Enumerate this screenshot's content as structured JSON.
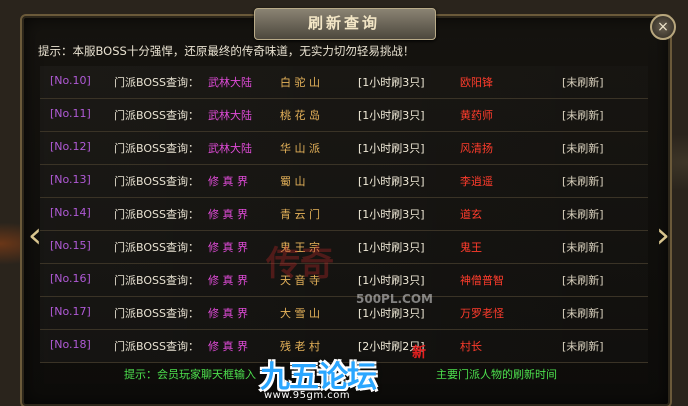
{
  "window": {
    "title": "刷新查询",
    "close_glyph": "×"
  },
  "tip_top": "提示：本服BOSS十分强悍，还原最终的传奇味道，无实力切勿轻易挑战！",
  "rows": [
    {
      "no": "[No.10]",
      "label": "门派BOSS查询：",
      "realm": "武林大陆",
      "place": "白 驼 山",
      "rate": "[1小时刷3只]",
      "boss": "欧阳锋",
      "status": "[未刷新]"
    },
    {
      "no": "[No.11]",
      "label": "门派BOSS查询：",
      "realm": "武林大陆",
      "place": "桃 花 岛",
      "rate": "[1小时刷3只]",
      "boss": "黄药师",
      "status": "[未刷新]"
    },
    {
      "no": "[No.12]",
      "label": "门派BOSS查询：",
      "realm": "武林大陆",
      "place": "华 山 派",
      "rate": "[1小时刷3只]",
      "boss": "风清扬",
      "status": "[未刷新]"
    },
    {
      "no": "[No.13]",
      "label": "门派BOSS查询：",
      "realm": "修 真 界",
      "place": "蜀  山",
      "rate": "[1小时刷3只]",
      "boss": "李逍遥",
      "status": "[未刷新]"
    },
    {
      "no": "[No.14]",
      "label": "门派BOSS查询：",
      "realm": "修 真 界",
      "place": "青 云 门",
      "rate": "[1小时刷3只]",
      "boss": "道玄",
      "status": "[未刷新]"
    },
    {
      "no": "[No.15]",
      "label": "门派BOSS查询：",
      "realm": "修 真 界",
      "place": "鬼 王 宗",
      "rate": "[1小时刷3只]",
      "boss": "鬼王",
      "status": "[未刷新]"
    },
    {
      "no": "[No.16]",
      "label": "门派BOSS查询：",
      "realm": "修 真 界",
      "place": "天 音 寺",
      "rate": "[1小时刷3只]",
      "boss": "神僧普智",
      "status": "[未刷新]"
    },
    {
      "no": "[No.17]",
      "label": "门派BOSS查询：",
      "realm": "修 真 界",
      "place": "大 雪 山",
      "rate": "[1小时刷3只]",
      "boss": "万罗老怪",
      "status": "[未刷新]"
    },
    {
      "no": "[No.18]",
      "label": "门派BOSS查询：",
      "realm": "修 真 界",
      "place": "残 老 村",
      "rate": "[2小时刷2只]",
      "boss": "村长",
      "status": "[未刷新]"
    }
  ],
  "tip_bottom_left": "提示：会员玩家聊天框输入",
  "tip_bottom_right": "主要门派人物的刷新时间",
  "watermark": {
    "text": "传奇",
    "site": "500PL.COM"
  },
  "logo": {
    "text": "九五论坛",
    "badge": "新",
    "url": "www.95gm.com"
  },
  "nav": {
    "prev": "‹",
    "next": "›"
  },
  "colors": {
    "frame": "#6b5a3a",
    "boss": "#ff3c2c",
    "realm": "#e04bd8",
    "tip_green": "#4de04d"
  }
}
